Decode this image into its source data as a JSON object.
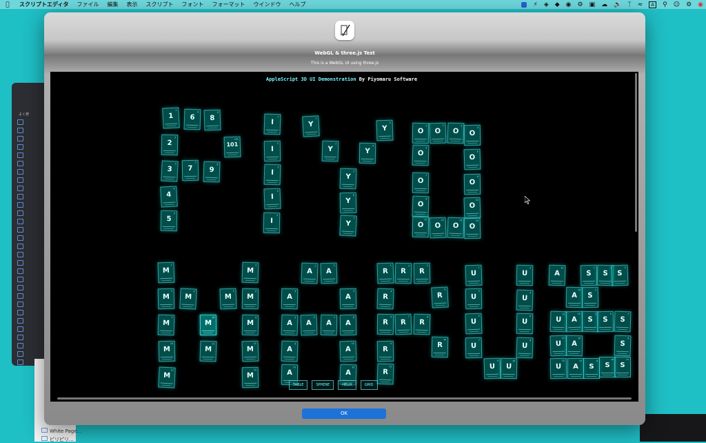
{
  "menubar": {
    "app_name": "スクリプトエディタ",
    "items": [
      "ファイル",
      "編集",
      "表示",
      "スクリプト",
      "フォント",
      "フォーマット",
      "ウインドウ",
      "ヘルプ"
    ]
  },
  "sidebar_bg": {
    "label": "よく使",
    "items": [
      "White Page...",
      "ピリピリ..."
    ]
  },
  "dialog": {
    "title": "WebGL & three.js Test",
    "subtitle": "This is a WebGL UI using three.js",
    "ok_label": "OK"
  },
  "demo": {
    "title_accent": "AppleScript 3D UI Demonstration",
    "title_rest": " By Piyomaru Software",
    "buttons": [
      "TABLE",
      "SPHERE",
      "HELIX",
      "GRID"
    ]
  },
  "tiles": [
    {
      "s": "1",
      "n": "1"
    },
    {
      "s": "6",
      "n": "6"
    },
    {
      "s": "8",
      "n": "8"
    },
    {
      "s": "2",
      "n": "2"
    },
    {
      "s": "101",
      "n": "101"
    },
    {
      "s": "3",
      "n": "3"
    },
    {
      "s": "7",
      "n": "7"
    },
    {
      "s": "9",
      "n": "9"
    },
    {
      "s": "4",
      "n": "4"
    },
    {
      "s": "5",
      "n": "5"
    },
    {
      "s": "I",
      "n": "1"
    },
    {
      "s": "I",
      "n": "2"
    },
    {
      "s": "I",
      "n": "3"
    },
    {
      "s": "I",
      "n": "4"
    },
    {
      "s": "I",
      "n": "5"
    },
    {
      "s": "Y",
      "n": "1"
    },
    {
      "s": "Y",
      "n": "2"
    },
    {
      "s": "Y",
      "n": "3"
    },
    {
      "s": "Y",
      "n": "4"
    },
    {
      "s": "Y",
      "n": "5"
    },
    {
      "s": "Y",
      "n": "6"
    },
    {
      "s": "Y",
      "n": "7"
    },
    {
      "s": "O",
      "n": "1"
    },
    {
      "s": "O",
      "n": "2"
    },
    {
      "s": "O",
      "n": "3"
    },
    {
      "s": "O",
      "n": "4"
    },
    {
      "s": "O",
      "n": "5"
    },
    {
      "s": "O",
      "n": "6"
    },
    {
      "s": "O",
      "n": "7"
    },
    {
      "s": "O",
      "n": "8"
    },
    {
      "s": "O",
      "n": "9"
    },
    {
      "s": "O",
      "n": "10"
    },
    {
      "s": "O",
      "n": "11"
    },
    {
      "s": "O",
      "n": "12"
    },
    {
      "s": "O",
      "n": "13"
    },
    {
      "s": "O",
      "n": "14"
    },
    {
      "s": "M",
      "n": "1"
    },
    {
      "s": "M",
      "n": "2"
    },
    {
      "s": "M",
      "n": "3"
    },
    {
      "s": "M",
      "n": "4"
    },
    {
      "s": "M",
      "n": "5"
    },
    {
      "s": "M",
      "n": "6"
    },
    {
      "s": "M",
      "n": "7"
    },
    {
      "s": "M",
      "n": "8"
    },
    {
      "s": "M",
      "n": "9"
    },
    {
      "s": "M",
      "n": "10"
    },
    {
      "s": "M",
      "n": "11"
    },
    {
      "s": "M",
      "n": "12"
    },
    {
      "s": "M",
      "n": "13"
    },
    {
      "s": "M",
      "n": "14"
    },
    {
      "s": "M",
      "n": "15"
    },
    {
      "s": "A",
      "n": "1"
    },
    {
      "s": "A",
      "n": "2"
    },
    {
      "s": "A",
      "n": "3"
    },
    {
      "s": "A",
      "n": "4"
    },
    {
      "s": "A",
      "n": "5"
    },
    {
      "s": "A",
      "n": "6"
    },
    {
      "s": "A",
      "n": "7"
    },
    {
      "s": "A",
      "n": "8"
    },
    {
      "s": "A",
      "n": "9"
    },
    {
      "s": "A",
      "n": "10"
    },
    {
      "s": "A",
      "n": "11"
    },
    {
      "s": "A",
      "n": "12"
    },
    {
      "s": "R",
      "n": "1"
    },
    {
      "s": "R",
      "n": "2"
    },
    {
      "s": "R",
      "n": "3"
    },
    {
      "s": "R",
      "n": "4"
    },
    {
      "s": "R",
      "n": "5"
    },
    {
      "s": "R",
      "n": "6"
    },
    {
      "s": "R",
      "n": "7"
    },
    {
      "s": "R",
      "n": "8"
    },
    {
      "s": "R",
      "n": "9"
    },
    {
      "s": "R",
      "n": "10"
    },
    {
      "s": "R",
      "n": "11"
    },
    {
      "s": "U",
      "n": "1"
    },
    {
      "s": "U",
      "n": "2"
    },
    {
      "s": "U",
      "n": "3"
    },
    {
      "s": "U",
      "n": "4"
    },
    {
      "s": "U",
      "n": "5"
    },
    {
      "s": "U",
      "n": "6"
    },
    {
      "s": "U",
      "n": "7"
    },
    {
      "s": "U",
      "n": "8"
    },
    {
      "s": "U",
      "n": "9"
    },
    {
      "s": "U",
      "n": "10"
    },
    {
      "s": "A",
      "n": "13"
    },
    {
      "s": "S",
      "n": "1"
    },
    {
      "s": "S",
      "n": "2"
    },
    {
      "s": "S",
      "n": "3"
    },
    {
      "s": "A",
      "n": "14"
    },
    {
      "s": "S",
      "n": "4"
    },
    {
      "s": "U",
      "n": "11"
    },
    {
      "s": "A",
      "n": "15"
    },
    {
      "s": "S",
      "n": "5"
    },
    {
      "s": "S",
      "n": "6"
    },
    {
      "s": "S",
      "n": "7"
    },
    {
      "s": "U",
      "n": "12"
    },
    {
      "s": "A",
      "n": "16"
    },
    {
      "s": "S",
      "n": "8"
    },
    {
      "s": "U",
      "n": "13"
    },
    {
      "s": "A",
      "n": "17"
    },
    {
      "s": "S",
      "n": "9"
    },
    {
      "s": "S",
      "n": "10"
    },
    {
      "s": "S",
      "n": "11"
    }
  ],
  "colors": {
    "accent": "#1d72d8",
    "tile": "#0aa7a0",
    "glow": "#7fffff"
  }
}
